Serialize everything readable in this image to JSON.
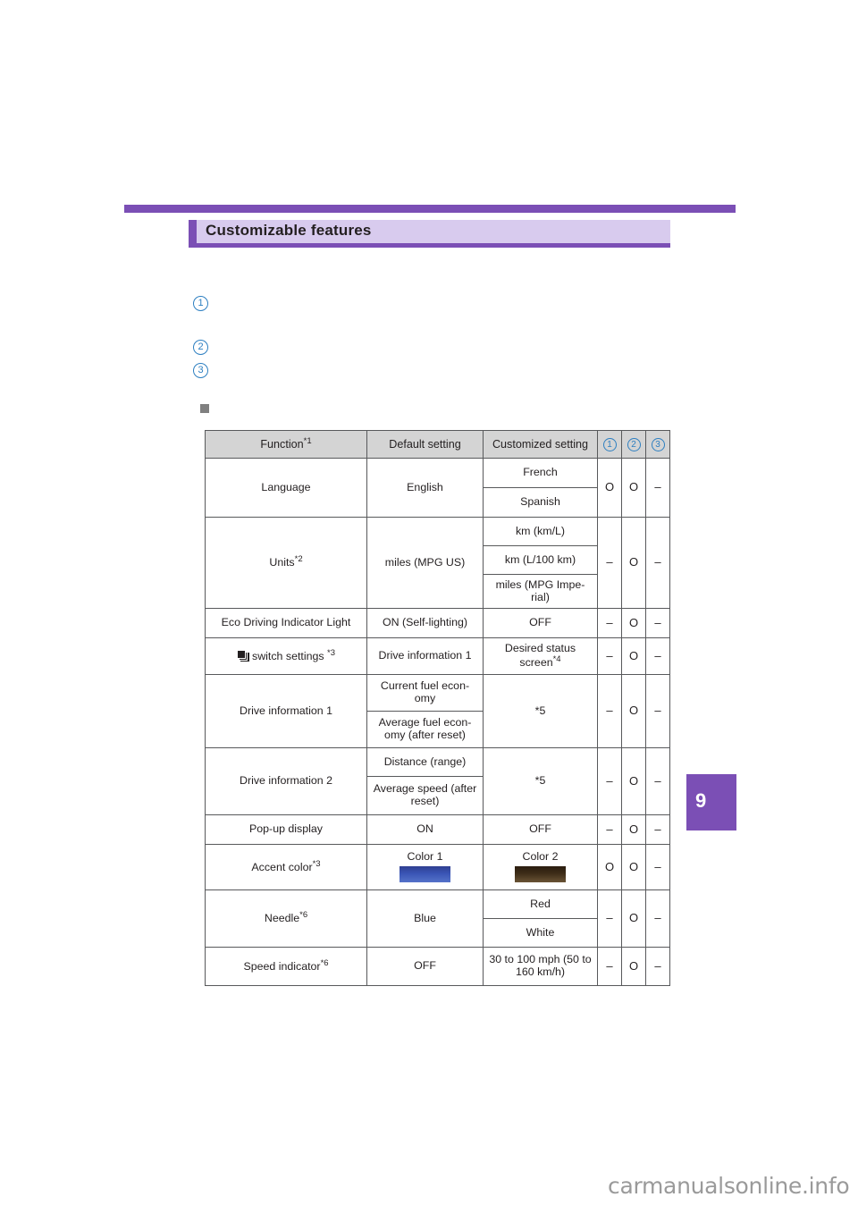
{
  "section": {
    "heading": "Customizable features"
  },
  "callouts": [
    {
      "label": "1"
    },
    {
      "label": "2"
    },
    {
      "label": "3"
    }
  ],
  "page_tab": {
    "number": "9",
    "color": "#7b4fb5"
  },
  "colors": {
    "accent_purple": "#7b4fb5",
    "heading_band": "#d8cbee",
    "table_header_bg": "#d4d4d4",
    "callout_blue": "#2d7fc1",
    "swatch_color_1": "#3a55b5",
    "swatch_color_2": "#3d2c18"
  },
  "table": {
    "headers": {
      "function": "Function",
      "function_footnote": "*1",
      "default_setting": "Default setting",
      "customized_setting": "Customized setting",
      "col_1": "1",
      "col_2": "2",
      "col_3": "3"
    },
    "rows": [
      {
        "function": "Language",
        "function_footnote": "",
        "default": "English",
        "customized": [
          "French",
          "Spanish"
        ],
        "marks": [
          "O",
          "O",
          "–"
        ]
      },
      {
        "function": "Units",
        "function_footnote": "*2",
        "default": "miles (MPG US)",
        "customized": [
          "km (km/L)",
          "km (L/100 km)",
          "miles (MPG Impe-rial)"
        ],
        "marks": [
          "–",
          "O",
          "–"
        ]
      },
      {
        "function": "Eco Driving Indicator Light",
        "function_footnote": "",
        "default": "ON (Self-lighting)",
        "customized": [
          "OFF"
        ],
        "marks": [
          "–",
          "O",
          "–"
        ]
      },
      {
        "function": "switch settings ",
        "function_icon": "stacked-pages-icon",
        "function_footnote": "*3",
        "default": "Drive information 1",
        "customized": [
          "Desired status screen"
        ],
        "customized_footnote": "*4",
        "marks": [
          "–",
          "O",
          "–"
        ]
      },
      {
        "function": "Drive information 1",
        "function_footnote": "",
        "default_multi": [
          "Current fuel econ-omy",
          "Average fuel econ-omy (after reset)"
        ],
        "customized": [
          "*5"
        ],
        "marks": [
          "–",
          "O",
          "–"
        ]
      },
      {
        "function": "Drive information 2",
        "function_footnote": "",
        "default_multi": [
          "Distance (range)",
          "Average speed (after reset)"
        ],
        "customized": [
          "*5"
        ],
        "marks": [
          "–",
          "O",
          "–"
        ]
      },
      {
        "function": "Pop-up display",
        "function_footnote": "",
        "default": "ON",
        "customized": [
          "OFF"
        ],
        "marks": [
          "–",
          "O",
          "–"
        ]
      },
      {
        "function": "Accent color",
        "function_footnote": "*3",
        "default": "Color 1",
        "default_swatch": "swatch-blue",
        "customized": [
          "Color 2"
        ],
        "customized_swatch": "swatch-brown",
        "marks": [
          "O",
          "O",
          "–"
        ]
      },
      {
        "function": "Needle",
        "function_footnote": "*6",
        "default": "Blue",
        "customized": [
          "Red",
          "White"
        ],
        "marks": [
          "–",
          "O",
          "–"
        ]
      },
      {
        "function": "Speed indicator",
        "function_footnote": "*6",
        "default": "OFF",
        "customized": [
          "30 to 100 mph (50 to 160 km/h)"
        ],
        "marks": [
          "–",
          "O",
          "–"
        ]
      }
    ]
  },
  "watermark": {
    "text": "carmanualsonline.info"
  }
}
